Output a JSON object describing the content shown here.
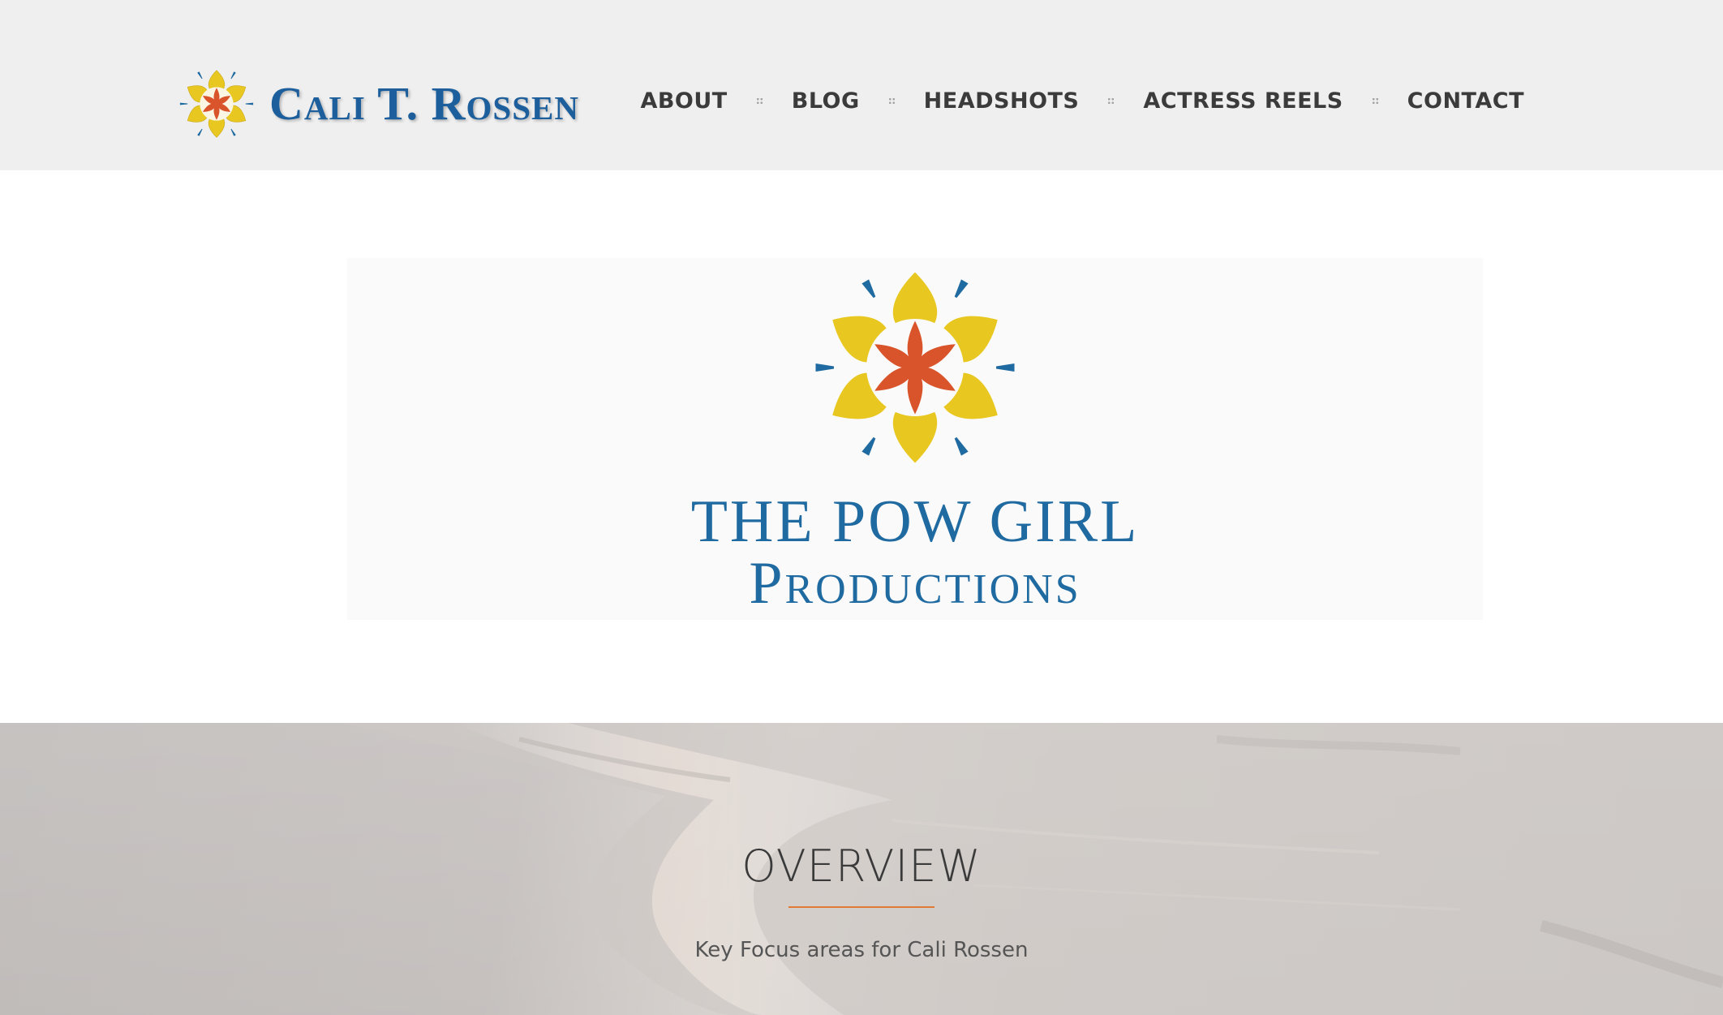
{
  "header": {
    "brand_name": "Cali T. Rossen",
    "nav": {
      "items": [
        {
          "label": "ABOUT"
        },
        {
          "label": "BLOG"
        },
        {
          "label": "HEADSHOTS"
        },
        {
          "label": "ACTRESS REELS"
        },
        {
          "label": "CONTACT"
        }
      ]
    }
  },
  "banner": {
    "title_line1": "THE POW GIRL",
    "title_line2": "Productions"
  },
  "overview": {
    "title": "OVERVIEW",
    "subtitle": "Key Focus areas for Cali Rossen"
  },
  "colors": {
    "header_bg": "#efefef",
    "brand_blue": "#1c5f9c",
    "logo_yellow": "#e8c820",
    "logo_orange": "#d9542a",
    "logo_blue": "#1f6aa0",
    "nav_text": "#3b3b3b",
    "accent_rule": "#e07a35"
  },
  "icons": {
    "brand_logo": "flower-logo-icon",
    "nav_separator": "dotted-square-separator-icon"
  }
}
